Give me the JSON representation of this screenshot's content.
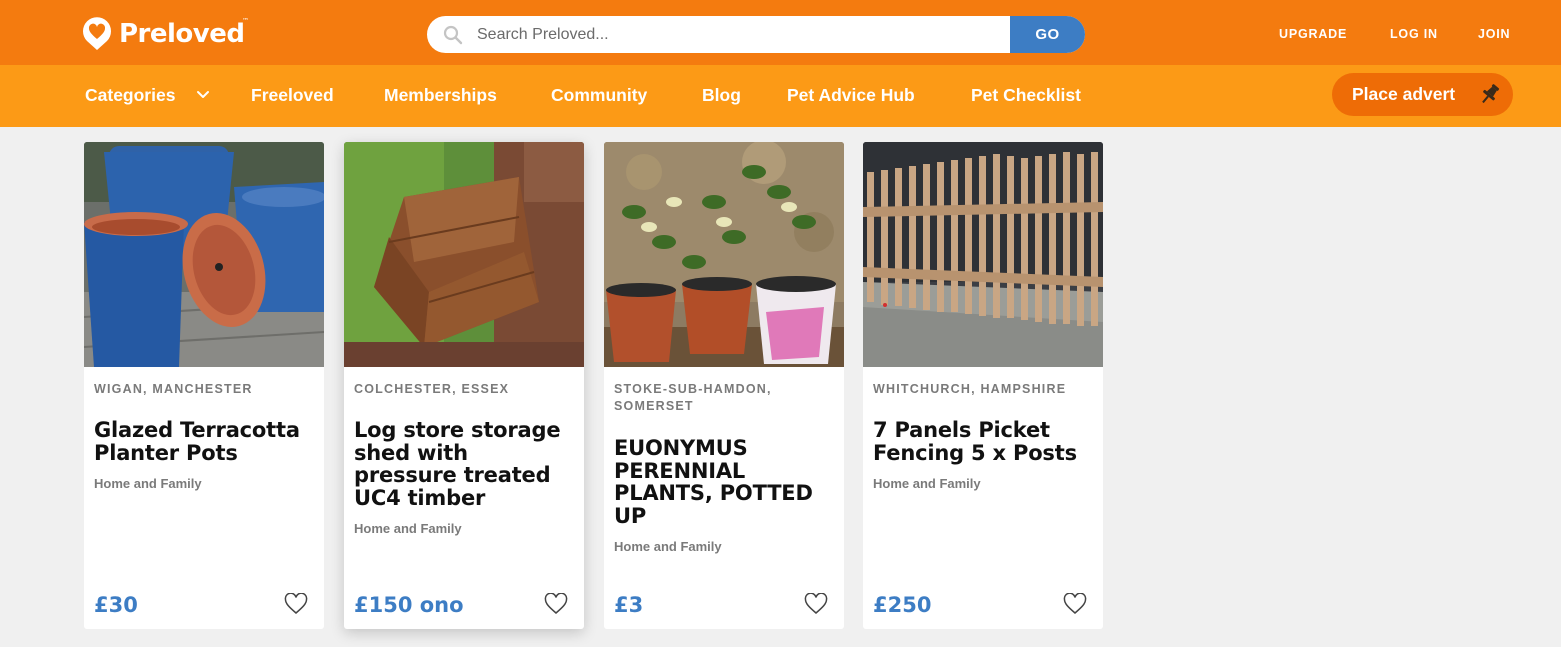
{
  "brand": {
    "name": "Preloved",
    "tm": "™",
    "color_primary": "#f47b0f",
    "color_nav": "#fc9a16",
    "color_accent": "#3d7dc4"
  },
  "search": {
    "placeholder": "Search Preloved...",
    "go_label": "GO"
  },
  "account_links": {
    "upgrade": "UPGRADE",
    "login": "LOG IN",
    "join": "JOIN"
  },
  "nav": {
    "categories": "Categories",
    "freeloved": "Freeloved",
    "memberships": "Memberships",
    "community": "Community",
    "blog": "Blog",
    "pet_advice": "Pet Advice Hub",
    "pet_checklist": "Pet Checklist",
    "place_advert": "Place advert"
  },
  "listings": [
    {
      "location": "WIGAN, MANCHESTER",
      "title": "Glazed Terracotta Planter Pots",
      "category": "Home and Family",
      "price": "£30",
      "image": "blue-glazed-pots-photo"
    },
    {
      "location": "COLCHESTER, ESSEX",
      "title": "Log store storage shed with pressure treated UC4 timber",
      "category": "Home and Family",
      "price": "£150 ono",
      "image": "wooden-log-store-photo"
    },
    {
      "location": "STOKE-SUB-HAMDON, SOMERSET",
      "title": "EUONYMUS PERENNIAL PLANTS, POTTED UP",
      "category": "Home and Family",
      "price": "£3",
      "image": "potted-plants-photo"
    },
    {
      "location": "WHITCHURCH, HAMPSHIRE",
      "title": "7 Panels Picket Fencing 5 x Posts",
      "category": "Home and Family",
      "price": "£250",
      "image": "picket-fence-photo"
    }
  ]
}
